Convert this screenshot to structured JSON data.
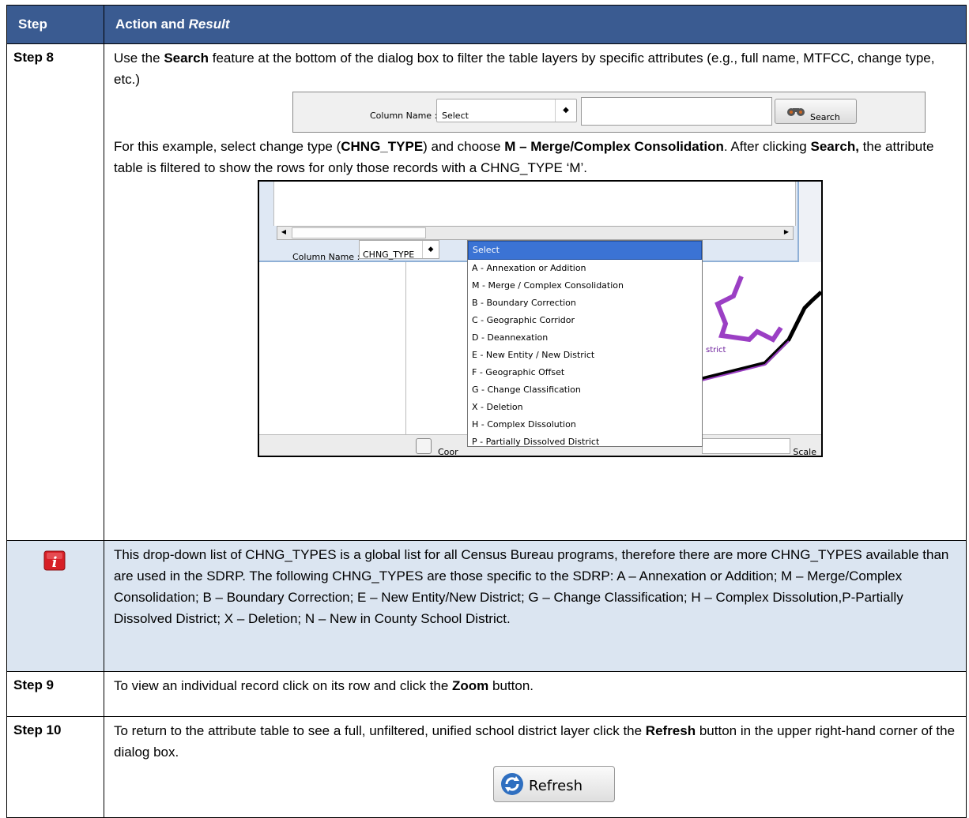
{
  "header": {
    "step": "Step",
    "action": "Action and ",
    "result": "Result"
  },
  "step8": {
    "label": "Step 8",
    "p1_a": "Use the ",
    "p1_b": "Search",
    "p1_c": " feature at the bottom of the dialog box to filter the table layers by specific attributes (e.g., full name, MTFCC, change type, etc.)",
    "searchbar": {
      "column_label": "Column Name :",
      "select_value": "Select",
      "button": "Search"
    },
    "p2_a": "For this example, select change type (",
    "p2_b": "CHNG_TYPE",
    "p2_c": ") and choose ",
    "p2_d": "M – Merge/Complex Consolidation",
    "p2_e": ". After clicking ",
    "p2_f": "Search,",
    "p2_g": " the attribute table is filtered to show the rows for only those records with a CHNG_TYPE ‘M’.",
    "dropdown": {
      "column_label": "Column Name :",
      "column_value": "CHNG_TYPE",
      "items": [
        "Select",
        "A - Annexation or Addition",
        "M - Merge / Complex Consolidation",
        "B - Boundary Correction",
        "C - Geographic Corridor",
        "D - Deannexation",
        "E - New Entity / New District",
        "F - Geographic Offset",
        "G - Change Classification",
        "X - Deletion",
        "H - Complex Dissolution",
        "P - Partially Dissolved District"
      ],
      "status_coor": "Coor",
      "status_scale": "Scale",
      "map_text": "strict"
    }
  },
  "note": {
    "text": "This drop-down list of CHNG_TYPES is a global list for all Census Bureau programs, therefore there are more CHNG_TYPES available than are used in the SDRP. The following CHNG_TYPES are those specific to the SDRP: A – Annexation or Addition; M – Merge/Complex Consolidation; B – Boundary Correction; E – New Entity/New District; G – Change Classification; H – Complex Dissolution,P-Partially Dissolved District; X – Deletion; N – New in County School District.",
    "icon_color": "#d71f26"
  },
  "step9": {
    "label": "Step 9",
    "a": "To view an individual record click on its row and click the ",
    "b": "Zoom",
    "c": " button."
  },
  "step10": {
    "label": "Step 10",
    "a": "To return to the attribute table to see a full, unfiltered, unified school district layer click the ",
    "b": "Refresh",
    "c": " button in the upper right-hand corner of the dialog box.",
    "button": "Refresh"
  },
  "colors": {
    "header_bg": "#3a5b91",
    "note_bg": "#dbe5f1",
    "highlight": "#3b73d4"
  }
}
